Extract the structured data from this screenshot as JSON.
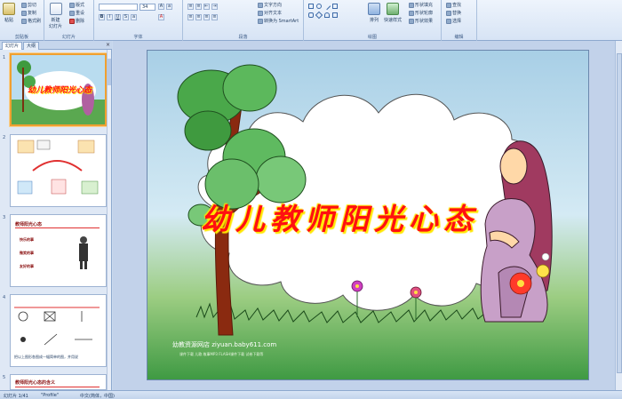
{
  "ribbon": {
    "clipboard": {
      "label": "剪贴板",
      "paste": "粘贴",
      "cut": "剪切",
      "copy": "复制",
      "format_painter": "格式刷"
    },
    "slides": {
      "label": "幻灯片",
      "new_slide": "新建\n幻灯片",
      "layout": "版式",
      "reset": "重设",
      "delete": "删除"
    },
    "font": {
      "label": "字体",
      "font_name": "",
      "font_size": "34"
    },
    "paragraph": {
      "label": "段落",
      "text_direction": "文字方向",
      "align_text": "对齐文本",
      "smartart": "转换为 SmartArt"
    },
    "drawing": {
      "label": "绘图",
      "arrange": "排列",
      "quick_styles": "快速样式",
      "shape_fill": "形状填充",
      "shape_outline": "形状轮廓",
      "shape_effects": "形状效果"
    },
    "editing": {
      "label": "编辑",
      "find": "查找",
      "replace": "替换",
      "select": "选择"
    }
  },
  "panel": {
    "tab_slides": "幻灯片",
    "tab_outline": "大纲",
    "close": "×",
    "thumbs": [
      {
        "num": "1",
        "title": "幼儿教师阳光心态"
      },
      {
        "num": "2",
        "title": ""
      },
      {
        "num": "3",
        "title": "教师阳光心态",
        "items": [
          "快乐的事",
          "微笑的事",
          "友好的事"
        ]
      },
      {
        "num": "4",
        "caption": "把以上图形各图成一幅简单的图，并用说"
      },
      {
        "num": "5",
        "title": "教师阳光心态的含义"
      }
    ]
  },
  "slide": {
    "title": "幼儿教师阳光心态",
    "watermark": "幼教资源网店  ziyuan.baby611.com",
    "watermark_sub": "课件下载    儿歌    故事MP3    FLASH课件下载    试卷下载等"
  },
  "status": {
    "slide_count": "幻灯片 1/41",
    "theme": "\"Profile\"",
    "language": "中文(简体，中国)"
  },
  "colors": {
    "title_red": "#ff1010",
    "title_glow": "#ffe700",
    "selected_thumb": "#f0a030"
  }
}
